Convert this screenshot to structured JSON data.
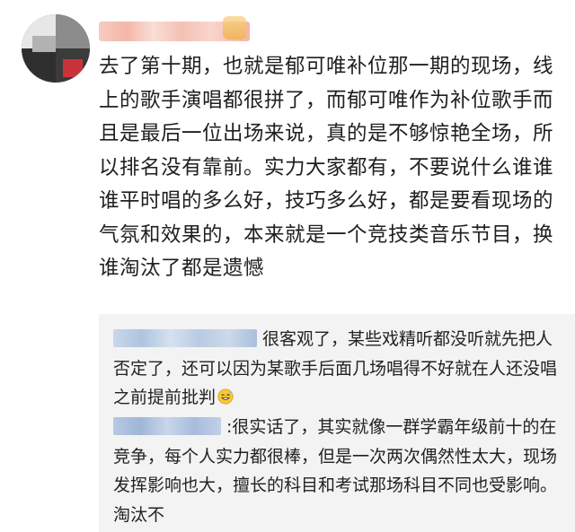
{
  "comment": {
    "avatar_icon": "user-avatar",
    "badge_icon": "member-badge",
    "text": "去了第十期，也就是郁可唯补位那一期的现场，线上的歌手演唱都很拼了，而郁可唯作为补位歌手而且是最后一位出场来说，真的是不够惊艳全场，所以排名没有靠前。实力大家都有，不要说什么谁谁谁平时唱的多么好，技巧多么好，都是要看现场的气氛和效果的，本来就是一个竞技类音乐节目，换谁淘汰了都是遗憾"
  },
  "replies": [
    {
      "text": "很客观了，某些戏精听都没听就先把人否定了，还可以因为某歌手后面几场唱得不好就在人还没唱之前提前批判",
      "emoji": "sweat-smile-emoji"
    },
    {
      "text": ":很实话了，其实就像一群学霸年级前十的在竞争，每个人实力都很棒，但是一次两次偶然性太大，现场发挥影响也大，擅长的科目和考试那场科目不同也受影响。淘汰不"
    }
  ],
  "colors": {
    "reply_background": "#f3f3f3",
    "text": "#222222",
    "username_blur": "#f2a99a",
    "reply_name_blur": "#aec4df"
  }
}
